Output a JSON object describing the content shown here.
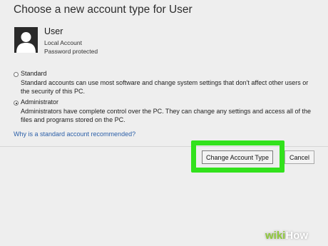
{
  "dialog": {
    "title": "Choose a new account type for User"
  },
  "user": {
    "name": "User",
    "account_type": "Local Account",
    "protection": "Password protected"
  },
  "options": {
    "standard": {
      "label": "Standard",
      "description": "Standard accounts can use most software and change system settings that don't affect other users or the security of this PC.",
      "selected": false
    },
    "administrator": {
      "label": "Administrator",
      "description": "Administrators have complete control over the PC. They can change any settings and access all of the files and programs stored on the PC.",
      "selected": true
    }
  },
  "help_link": "Why is a standard account recommended?",
  "buttons": {
    "change_account_type": "Change Account Type",
    "cancel": "Cancel"
  },
  "watermark": {
    "wiki": "wiki",
    "how": "How"
  },
  "colors": {
    "highlight": "#32e21c",
    "link": "#2b5fa8",
    "background": "#eeeeee"
  }
}
